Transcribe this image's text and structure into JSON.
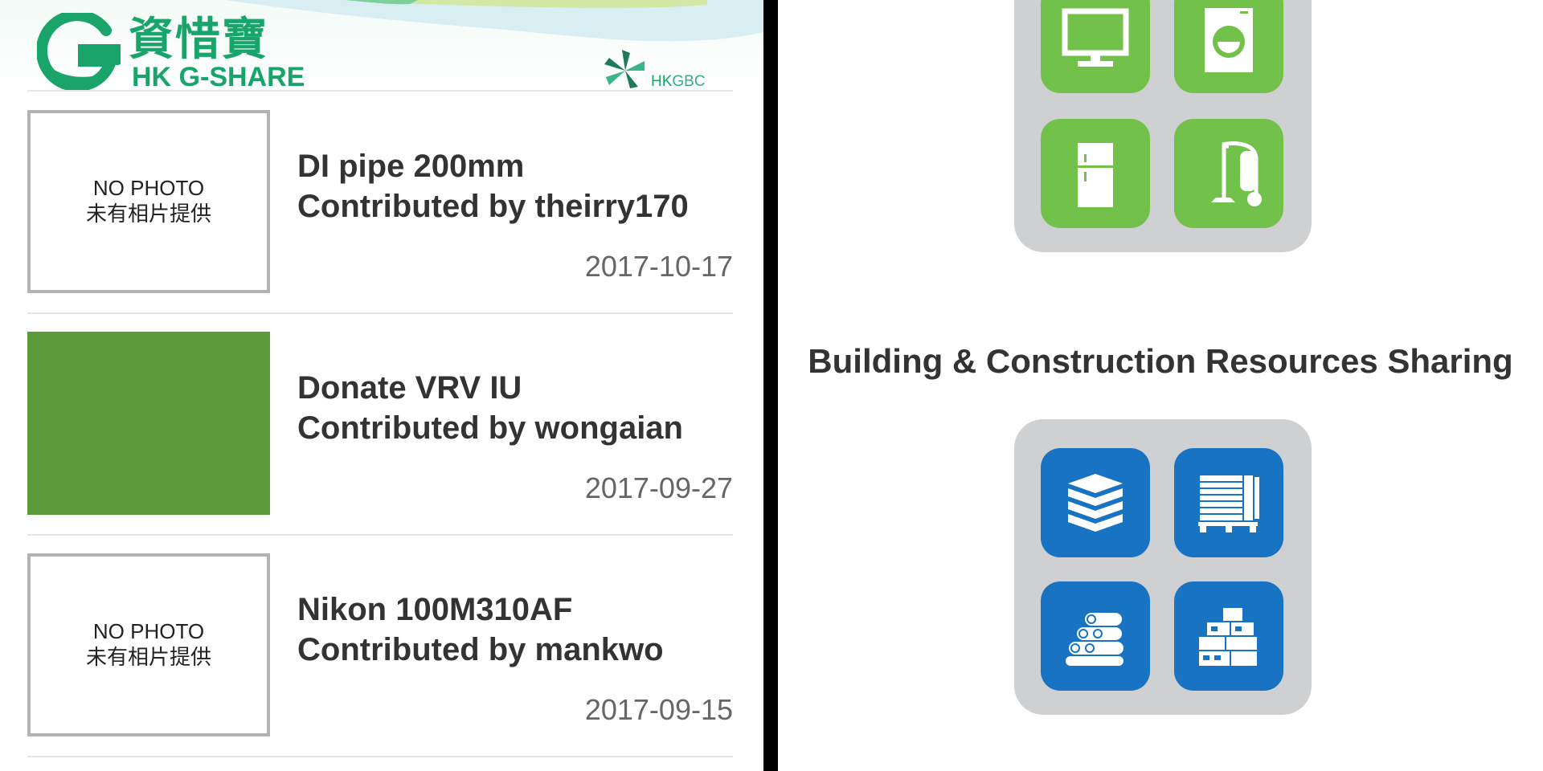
{
  "logo": {
    "chinese_name": "資惜寶",
    "english_name": "HK G-SHARE",
    "partner_text_hk": "HK",
    "partner_text_gbc": "GBC"
  },
  "placeholder": {
    "en": "NO PHOTO",
    "cn": "未有相片提供"
  },
  "listings": [
    {
      "title": "DI pipe 200mm",
      "contributor": "Contributed by theirry170",
      "date": "2017-10-17",
      "has_photo": false
    },
    {
      "title": "Donate VRV IU",
      "contributor": "Contributed by wongaian",
      "date": "2017-09-27",
      "has_photo": true
    },
    {
      "title": "Nikon 100M310AF",
      "contributor": "Contributed by mankwo",
      "date": "2017-09-15",
      "has_photo": false
    }
  ],
  "appliance_categories": {
    "tiles": [
      {
        "icon": "tv-icon"
      },
      {
        "icon": "washing-machine-icon"
      },
      {
        "icon": "refrigerator-icon"
      },
      {
        "icon": "vacuum-cleaner-icon"
      }
    ],
    "color": "#72c14a"
  },
  "building_section": {
    "heading": "Building & Construction Resources Sharing",
    "tiles": [
      {
        "icon": "stacked-boards-icon"
      },
      {
        "icon": "pallet-sheets-icon"
      },
      {
        "icon": "pipes-stack-icon"
      },
      {
        "icon": "bricks-blocks-icon"
      }
    ],
    "color": "#1873c2"
  },
  "colors": {
    "brand_green": "#19a56a",
    "no_photo_border": "#b3b3b3",
    "photo_fill": "#5f9a3a",
    "panel_gray": "#cfd0d2"
  }
}
